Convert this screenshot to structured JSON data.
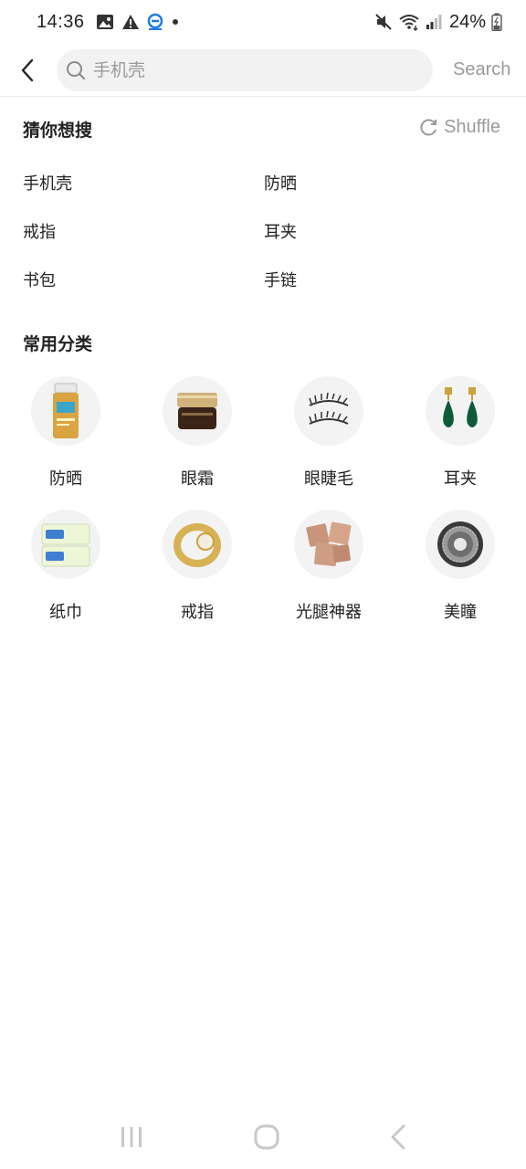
{
  "status_bar": {
    "time": "14:36",
    "battery": "24%",
    "icons_left": [
      "gallery-icon",
      "warning-icon",
      "app-notification-icon",
      "dot-icon"
    ],
    "icons_right": [
      "mute-icon",
      "wifi-icon",
      "signal-icon",
      "battery-icon"
    ]
  },
  "search": {
    "placeholder": "手机壳",
    "button_label": "Search"
  },
  "suggestions": {
    "title": "猜你想搜",
    "shuffle_label": "Shuffle",
    "items": [
      "手机壳",
      "防晒",
      "戒指",
      "耳夹",
      "书包",
      "手链"
    ]
  },
  "categories": {
    "title": "常用分类",
    "items": [
      {
        "label": "防晒",
        "icon": "sunscreen-icon"
      },
      {
        "label": "眼霜",
        "icon": "eye-cream-icon"
      },
      {
        "label": "眼睫毛",
        "icon": "eyelash-icon"
      },
      {
        "label": "耳夹",
        "icon": "earring-icon"
      },
      {
        "label": "纸巾",
        "icon": "tissue-icon"
      },
      {
        "label": "戒指",
        "icon": "ring-icon"
      },
      {
        "label": "光腿神器",
        "icon": "stockings-icon"
      },
      {
        "label": "美瞳",
        "icon": "contact-lens-icon"
      }
    ]
  },
  "nav": {
    "icons": [
      "recent-apps-icon",
      "home-icon",
      "back-nav-icon"
    ]
  },
  "colors": {
    "text": "#222222",
    "muted": "#999999",
    "search_bg": "#f2f2f2",
    "circle_bg": "#f3f3f3"
  }
}
